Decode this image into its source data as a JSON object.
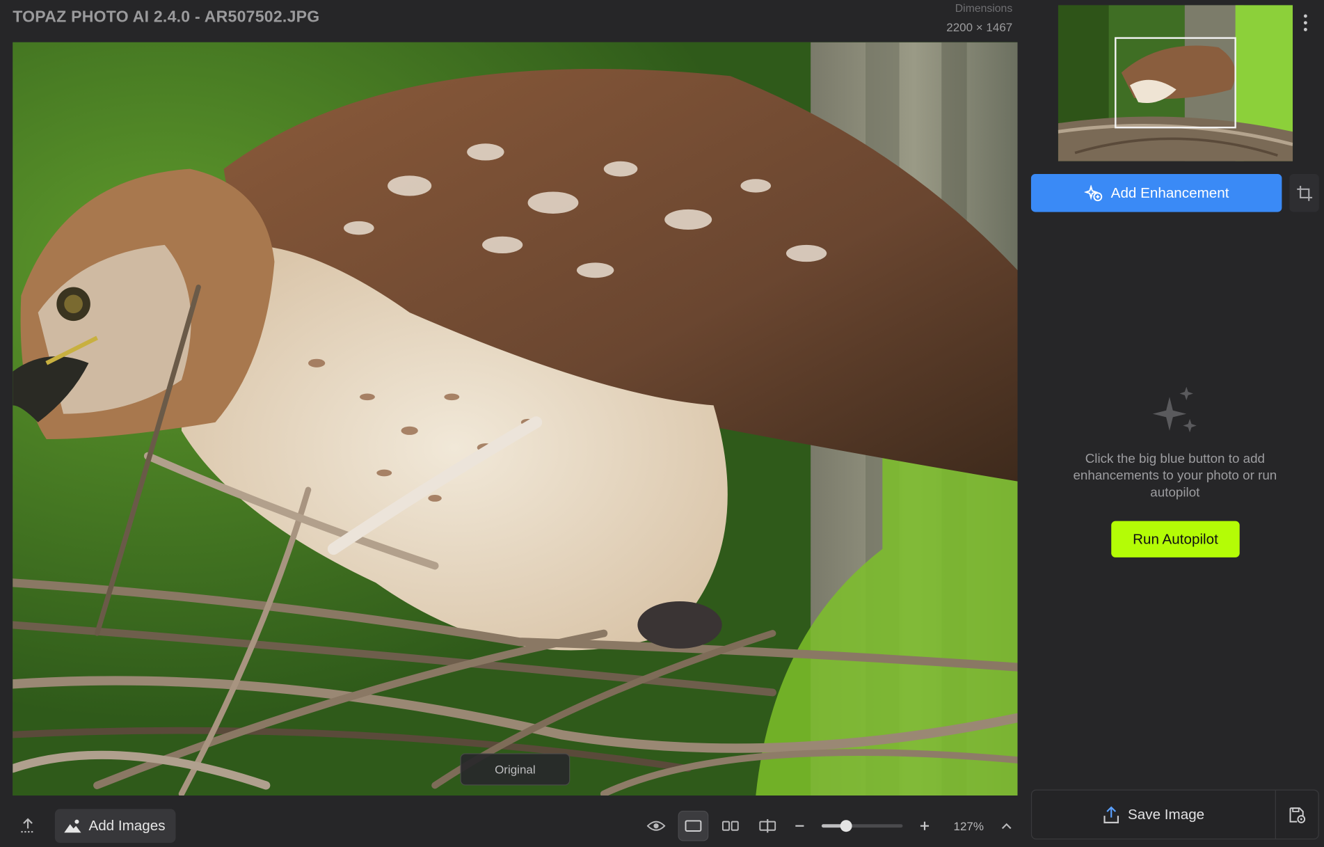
{
  "window": {
    "title": "TOPAZ PHOTO AI 2.4.0 - AR507502.JPG",
    "dimensions_label": "Dimensions",
    "dimensions_value": "2200 × 1467"
  },
  "canvas": {
    "view_label": "Original"
  },
  "toolbar": {
    "upload_icon": "upload-icon",
    "add_images_label": "Add Images",
    "preview_icon": "eye-icon",
    "views": [
      "single-view-icon",
      "side-by-side-view-icon",
      "split-view-icon"
    ],
    "active_view": "single-view-icon",
    "zoom_level_percent": 127,
    "zoom_text": "127%",
    "zoom_slider_fraction": 0.3
  },
  "panel": {
    "add_enhancement_label": "Add Enhancement",
    "empty_message": "Click the big blue button to add enhancements to your photo or run autopilot",
    "run_autopilot_label": "Run Autopilot",
    "save_image_label": "Save Image"
  },
  "colors": {
    "accent_blue": "#3a8af6",
    "autopilot_green": "#b4fc06",
    "background": "#262628"
  }
}
